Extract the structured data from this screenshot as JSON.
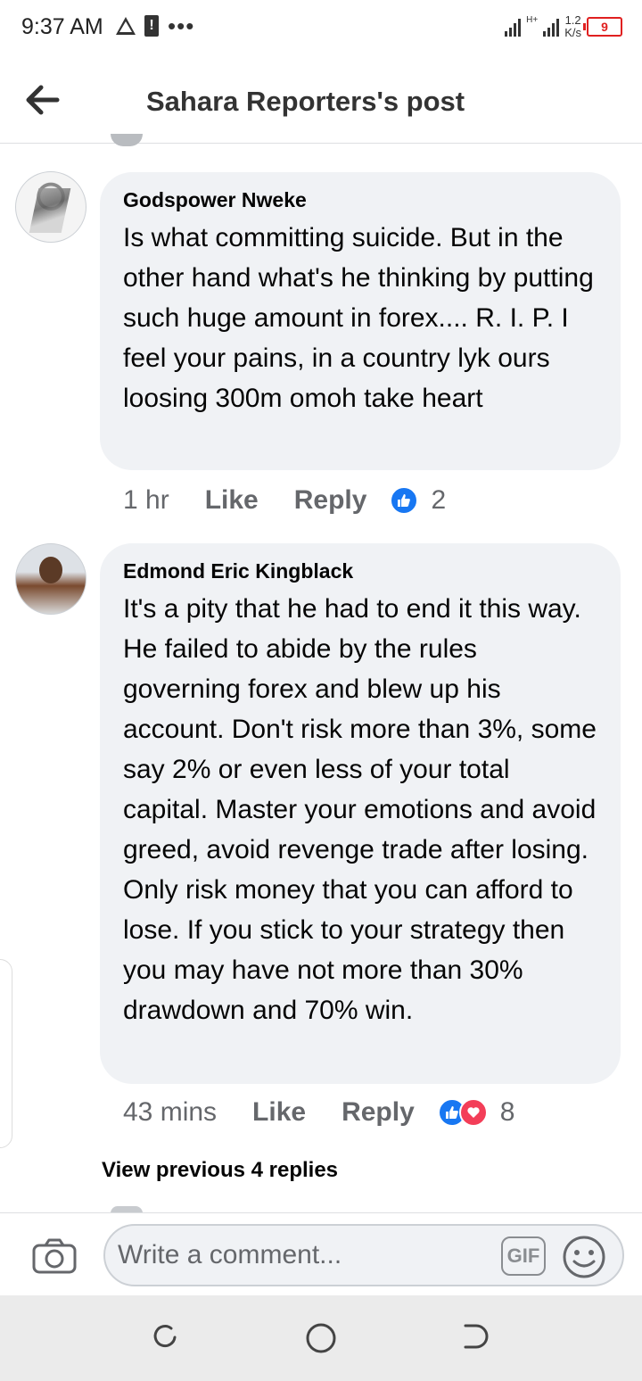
{
  "status_bar": {
    "time": "9:37 AM",
    "sim_alert": "!",
    "more": "•••",
    "network_type": "H+",
    "speed_value": "1.2",
    "speed_unit": "K/s",
    "battery_level": "9"
  },
  "header": {
    "title": "Sahara Reporters's post",
    "back_icon": "arrow-left-icon"
  },
  "comments": [
    {
      "author": "Godspower Nweke",
      "text": "Is what committing suicide. But in the other hand what's he thinking by putting such huge amount in forex.... R. I. P. I feel your pains, in a country lyk ours loosing 300m omoh take heart",
      "time": "1 hr",
      "like_label": "Like",
      "reply_label": "Reply",
      "reaction_count": "2",
      "reactions": [
        "like"
      ]
    },
    {
      "author": "Edmond Eric Kingblack",
      "text": "It's a pity that he had to end it this way. He failed to abide by the rules governing forex and blew up his account. Don't risk more than 3%, some say 2% or even less of your total capital. Master your emotions and avoid greed, avoid revenge trade after losing. Only risk money that you can afford to lose. If you stick to your strategy then you may have not more than 30% drawdown and 70% win.",
      "time": "43 mins",
      "like_label": "Like",
      "reply_label": "Reply",
      "reaction_count": "8",
      "reactions": [
        "like",
        "love"
      ]
    }
  ],
  "view_previous": "View previous 4 replies",
  "composer": {
    "placeholder": "Write a comment...",
    "gif_label": "GIF",
    "camera_icon": "camera-icon",
    "emoji_icon": "smiley-icon"
  },
  "colors": {
    "like_blue": "#1877f2",
    "love_red": "#f33e58",
    "bubble_bg": "#f0f2f5",
    "meta_gray": "#65676b"
  }
}
